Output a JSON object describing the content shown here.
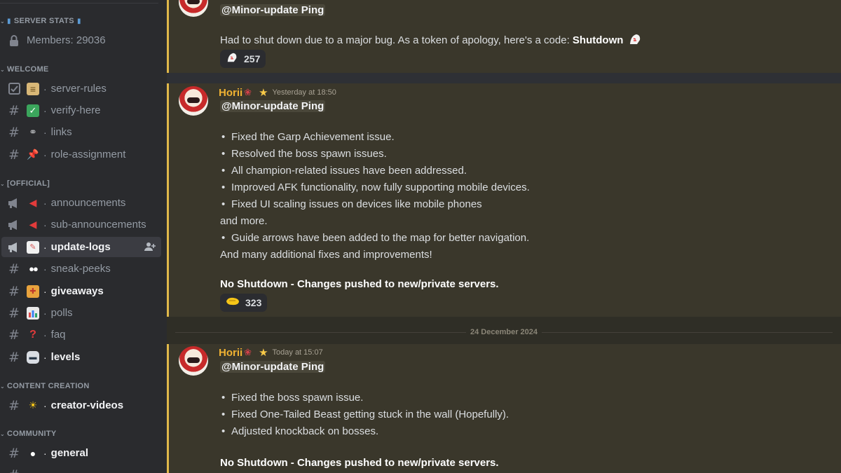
{
  "sidebar": {
    "categories": {
      "welcome": "WELCOME",
      "official": "[OFFICIAL]",
      "content": "CONTENT CREATION",
      "community": "COMMUNITY"
    },
    "stats": {
      "header": "SERVER STATS",
      "members": "Members: 29036"
    },
    "channels": {
      "server_rules": "server-rules",
      "verify_here": "verify-here",
      "links": "links",
      "role_assignment": "role-assignment",
      "announcements": "announcements",
      "sub_announcements": "sub-announcements",
      "update_logs": "update-logs",
      "sneak_peeks": "sneak-peeks",
      "giveaways": "giveaways",
      "polls": "polls",
      "faq": "faq",
      "levels": "levels",
      "creator_videos": "creator-videos",
      "general": "general"
    }
  },
  "messages": [
    {
      "mention": "@Minor-update Ping",
      "text_prefix": "Had to shut down due to a major bug. As a token of apology, here's a code: ",
      "code": "Shutdown",
      "reaction_count": "257"
    },
    {
      "author": "Horii",
      "time": "Yesterday at 18:50",
      "mention": "@Minor-update Ping",
      "lines": [
        "Fixed the Garp Achievement issue.",
        "Resolved the boss spawn issues.",
        "All champion-related issues have been addressed.",
        "Improved AFK functionality, now fully supporting mobile devices.",
        "Fixed UI scaling issues on devices like mobile phones",
        "and more.",
        "Guide arrows have been added to the map for better navigation.",
        "And many additional fixes and improvements!"
      ],
      "footer": "No Shutdown - Changes pushed to new/private servers.",
      "reaction_count": "323"
    },
    {
      "author": "Horii",
      "time": "Today at 15:07",
      "mention": "@Minor-update Ping",
      "lines": [
        "Fixed the boss spawn issue.",
        "Fixed One-Tailed Beast getting stuck in the wall (Hopefully).",
        "Adjusted knockback on bosses."
      ],
      "footer": "No Shutdown - Changes pushed to new/private servers."
    }
  ],
  "date_divider": "24 December 2024",
  "colors": {
    "accent_bar": "#e0b84a",
    "author": "#f0b232",
    "sidebar_bg": "#2a2b2e",
    "message_bg": "#3a372b"
  }
}
